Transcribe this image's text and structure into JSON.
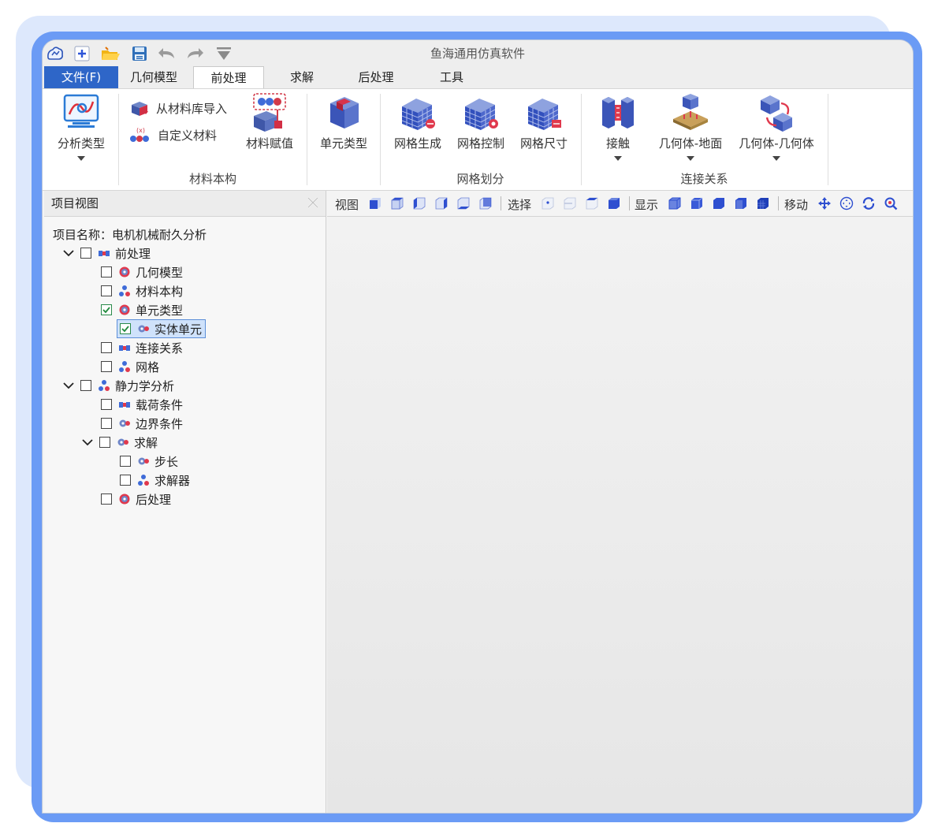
{
  "app": {
    "title": "鱼海通用仿真软件"
  },
  "tabs": [
    {
      "label": "文件(F)"
    },
    {
      "label": "几何模型"
    },
    {
      "label": "前处理"
    },
    {
      "label": "求解"
    },
    {
      "label": "后处理"
    },
    {
      "label": "工具"
    }
  ],
  "active_tab": "前处理",
  "ribbon": {
    "analysis_type": "分析类型",
    "import_from_library": "从材料库导入",
    "custom_material": "自定义材料",
    "assign_material": "材料赋值",
    "group_material": "材料本构",
    "element_type": "单元类型",
    "mesh_generate": "网格生成",
    "mesh_control": "网格控制",
    "mesh_size": "网格尺寸",
    "group_mesh": "网格划分",
    "contact": "接触",
    "body_ground": "几何体-地面",
    "body_body": "几何体-几何体",
    "group_connection": "连接关系"
  },
  "panel": {
    "title": "项目视图",
    "project_name": "项目名称：电机机械耐久分析",
    "tree": [
      {
        "label": "前处理",
        "checked": false,
        "expanded": true
      },
      {
        "label": "几何模型",
        "checked": false
      },
      {
        "label": "材料本构",
        "checked": false
      },
      {
        "label": "单元类型",
        "checked": true
      },
      {
        "label": "实体单元",
        "checked": true,
        "selected": true
      },
      {
        "label": "连接关系",
        "checked": false
      },
      {
        "label": "网格",
        "checked": false
      },
      {
        "label": "静力学分析",
        "checked": false,
        "expanded": true
      },
      {
        "label": "载荷条件",
        "checked": false
      },
      {
        "label": "边界条件",
        "checked": false
      },
      {
        "label": "求解",
        "checked": false,
        "expanded": true
      },
      {
        "label": "步长",
        "checked": false
      },
      {
        "label": "求解器",
        "checked": false
      },
      {
        "label": "后处理",
        "checked": false
      }
    ]
  },
  "view_toolbar": {
    "view_label": "视图",
    "select_label": "选择",
    "display_label": "显示",
    "move_label": "移动"
  },
  "colors": {
    "accent": "#2e66c8",
    "frame": "#6b9bf5",
    "mesh_blue": "#3d5bd6"
  }
}
